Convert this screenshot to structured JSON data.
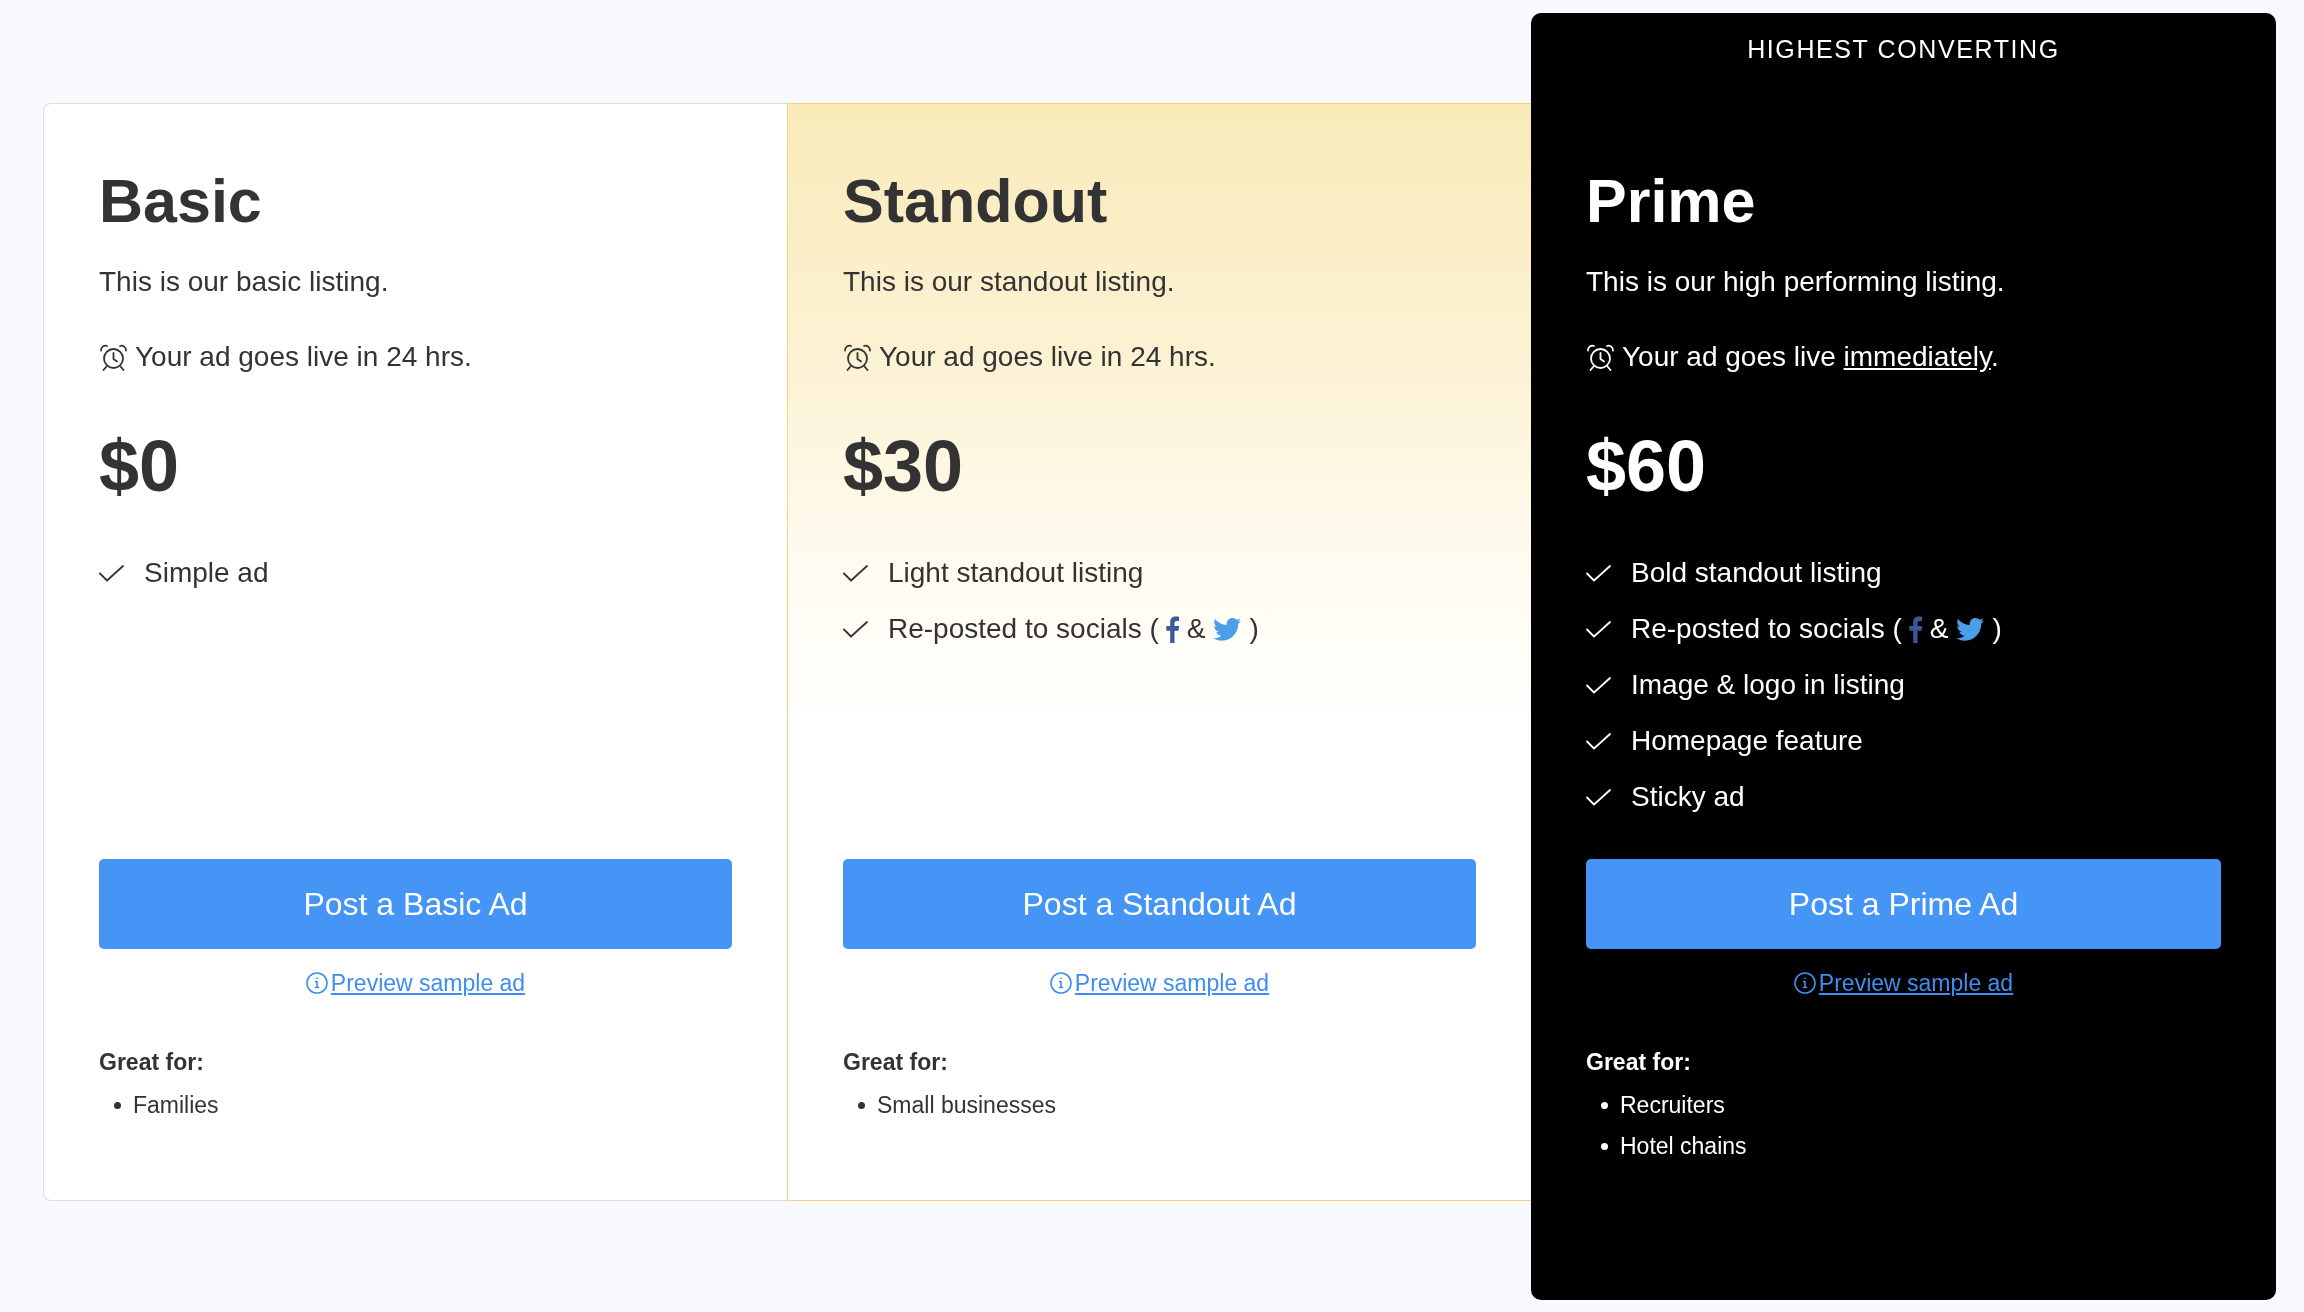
{
  "plans": [
    {
      "kind": "plain",
      "name": "Basic",
      "description": "This is our basic listing.",
      "go_live": {
        "text": "Your ad goes live in 24 hrs."
      },
      "price": "$0",
      "features": [
        {
          "kind": "text",
          "text": "Simple ad"
        }
      ],
      "button": "Post a Basic Ad",
      "preview_link": "Preview sample ad",
      "great_for": {
        "label": "Great for:",
        "items": [
          "Families"
        ]
      }
    },
    {
      "kind": "featured",
      "name": "Standout",
      "description": "This is our standout listing.",
      "go_live": {
        "text": "Your ad goes live in 24 hrs."
      },
      "price": "$30",
      "features": [
        {
          "kind": "text",
          "text": "Light standout listing"
        },
        {
          "kind": "socials",
          "text": "Re-posted to socials (",
          "joiner": "&",
          "close": ")"
        }
      ],
      "button": "Post a Standout Ad",
      "preview_link": "Preview sample ad",
      "great_for": {
        "label": "Great for:",
        "items": [
          "Small businesses"
        ]
      }
    },
    {
      "kind": "premium",
      "banner": "HIGHEST CONVERTING",
      "name": "Prime",
      "description": "This is our high performing listing.",
      "go_live": {
        "text": "Your ad goes live ",
        "underlined": "immediately",
        "after": "."
      },
      "price": "$60",
      "features": [
        {
          "kind": "text",
          "text": "Bold standout listing"
        },
        {
          "kind": "socials",
          "text": "Re-posted to socials (",
          "joiner": "&",
          "close": ")"
        },
        {
          "kind": "text",
          "text": "Image & logo in listing"
        },
        {
          "kind": "text",
          "text": "Homepage feature"
        },
        {
          "kind": "text",
          "text": "Sticky ad"
        }
      ],
      "button": "Post a Prime Ad",
      "preview_link": "Preview sample ad",
      "great_for": {
        "label": "Great for:",
        "items": [
          "Recruiters",
          "Hotel chains"
        ]
      }
    }
  ]
}
